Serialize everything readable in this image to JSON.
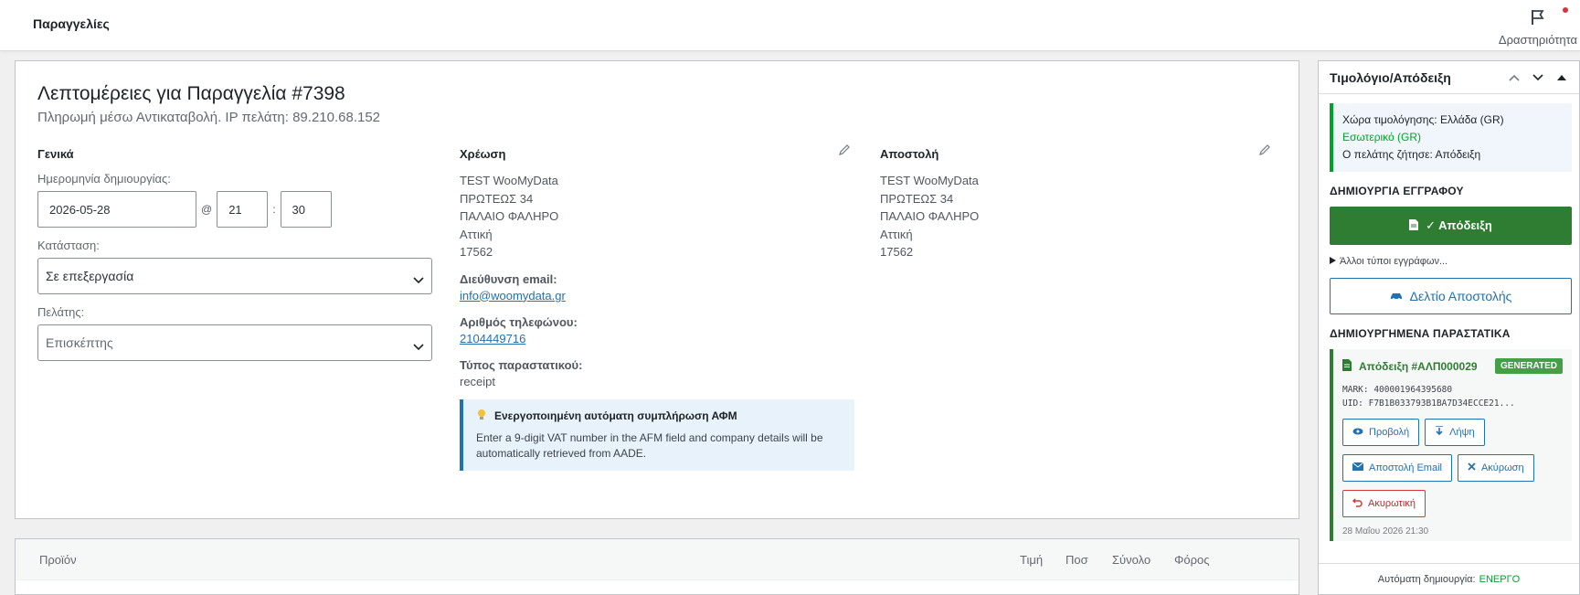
{
  "topbar": {
    "title": "Παραγγελίες",
    "activity_label": "Δραστηριότητα"
  },
  "order": {
    "heading": "Λεπτομέρειες για Παραγγελία #7398",
    "subheading": "Πληρωμή μέσω Αντικαταβολή. IP πελάτη: 89.210.68.152"
  },
  "general": {
    "title": "Γενικά",
    "date_label": "Ημερομηνία δημιουργίας:",
    "date_value": "2026-05-28",
    "at_sign": "@",
    "hour": "21",
    "colon": ":",
    "minute": "30",
    "status_label": "Κατάσταση:",
    "status_value": "Σε επεξεργασία",
    "customer_label": "Πελάτης:",
    "customer_value": "Επισκέπτης"
  },
  "billing": {
    "title": "Χρέωση",
    "address": [
      "TEST WooMyData",
      "ΠΡΩΤΕΩΣ 34",
      "ΠΑΛΑΙΟ ΦΑΛΗΡΟ",
      "Αττική",
      "17562"
    ],
    "email_label": "Διεύθυνση email:",
    "email": "info@woomydata.gr",
    "phone_label": "Αριθμός τηλεφώνου:",
    "phone": "2104449716",
    "doc_type_label": "Τύπος παραστατικού:",
    "doc_type": "receipt",
    "notice_title": "Ενεργοποιημένη αυτόματη συμπλήρωση ΑΦΜ",
    "notice_body": "Enter a 9-digit VAT number in the AFM field and company details will be automatically retrieved from AADE."
  },
  "shipping": {
    "title": "Αποστολή",
    "address": [
      "TEST WooMyData",
      "ΠΡΩΤΕΩΣ 34",
      "ΠΑΛΑΙΟ ΦΑΛΗΡΟ",
      "Αττική",
      "17562"
    ]
  },
  "items": {
    "headers": {
      "product": "Προϊόν",
      "price": "Τιμή",
      "qty": "Ποσ",
      "total": "Σύνολο",
      "tax": "Φόρος"
    }
  },
  "sidebar": {
    "title": "Τιμολόγιο/Απόδειξη",
    "country_label": "Χώρα τιμολόγησης:",
    "country_value": "Ελλάδα (GR)",
    "domestic": "Εσωτερικό (GR)",
    "requested_label": "Ο πελάτης ζήτησε:",
    "requested_value": "Απόδειξη",
    "create_section": "ΔΗΜΙΟΥΡΓΙΑ ΕΓΓΡΑΦΟΥ",
    "receipt_button": "✓ Απόδειξη",
    "other_types": "Άλλοι τύποι εγγράφων...",
    "delivery_button": "Δελτίο Αποστολής",
    "created_section": "ΔΗΜΙΟΥΡΓΗΜΕΝΑ ΠΑΡΑΣΤΑΤΙΚΑ",
    "doc": {
      "title": "Απόδειξη #ΑΛΠ000029",
      "badge": "GENERATED",
      "mark": "MARK: 400001964395680",
      "uid": "UID: F7B1B033793B1BA7D34ECCE21...",
      "view": "Προβολή",
      "download": "Λήψη",
      "email": "Αποστολή Email",
      "cancel": "Ακύρωση",
      "credit": "Ακυρωτική",
      "date": "28 Μαΐου 2026 21:30"
    },
    "auto_label": "Αυτόματη δημιουργία:",
    "auto_value": "ΕΝΕΡΓΟ"
  },
  "colors": {
    "accent": "#2271b1",
    "success": "#2e7d32",
    "danger": "#d63638"
  }
}
